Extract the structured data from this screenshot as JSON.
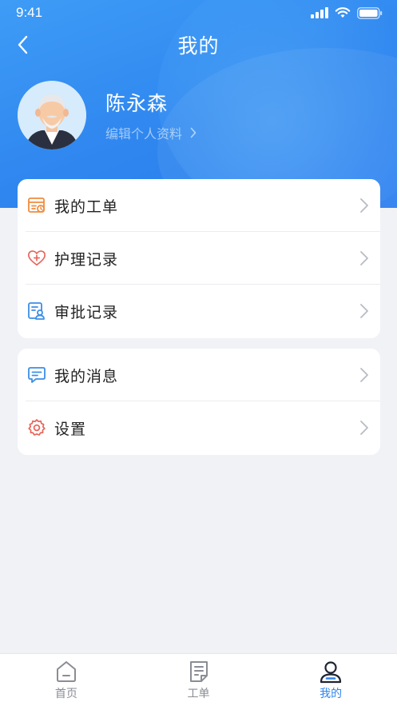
{
  "status_bar": {
    "time": "9:41"
  },
  "header": {
    "title": "我的"
  },
  "profile": {
    "name": "陈永森",
    "edit_label": "编辑个人资料"
  },
  "menu_group_1": [
    {
      "label": "我的工单",
      "icon": "work-order-icon"
    },
    {
      "label": "护理记录",
      "icon": "heart-plus-icon"
    },
    {
      "label": "审批记录",
      "icon": "approval-record-icon"
    }
  ],
  "menu_group_2": [
    {
      "label": "我的消息",
      "icon": "message-icon"
    },
    {
      "label": "设置",
      "icon": "settings-gear-icon"
    }
  ],
  "tab_bar": {
    "home_label": "首页",
    "orders_label": "工单",
    "mine_label": "我的",
    "active": "mine"
  },
  "colors": {
    "primary": "#2f86ef",
    "orange_icon": "#f08c3c",
    "red_icon": "#e8645a",
    "blue_icon": "#3b8fe8"
  }
}
